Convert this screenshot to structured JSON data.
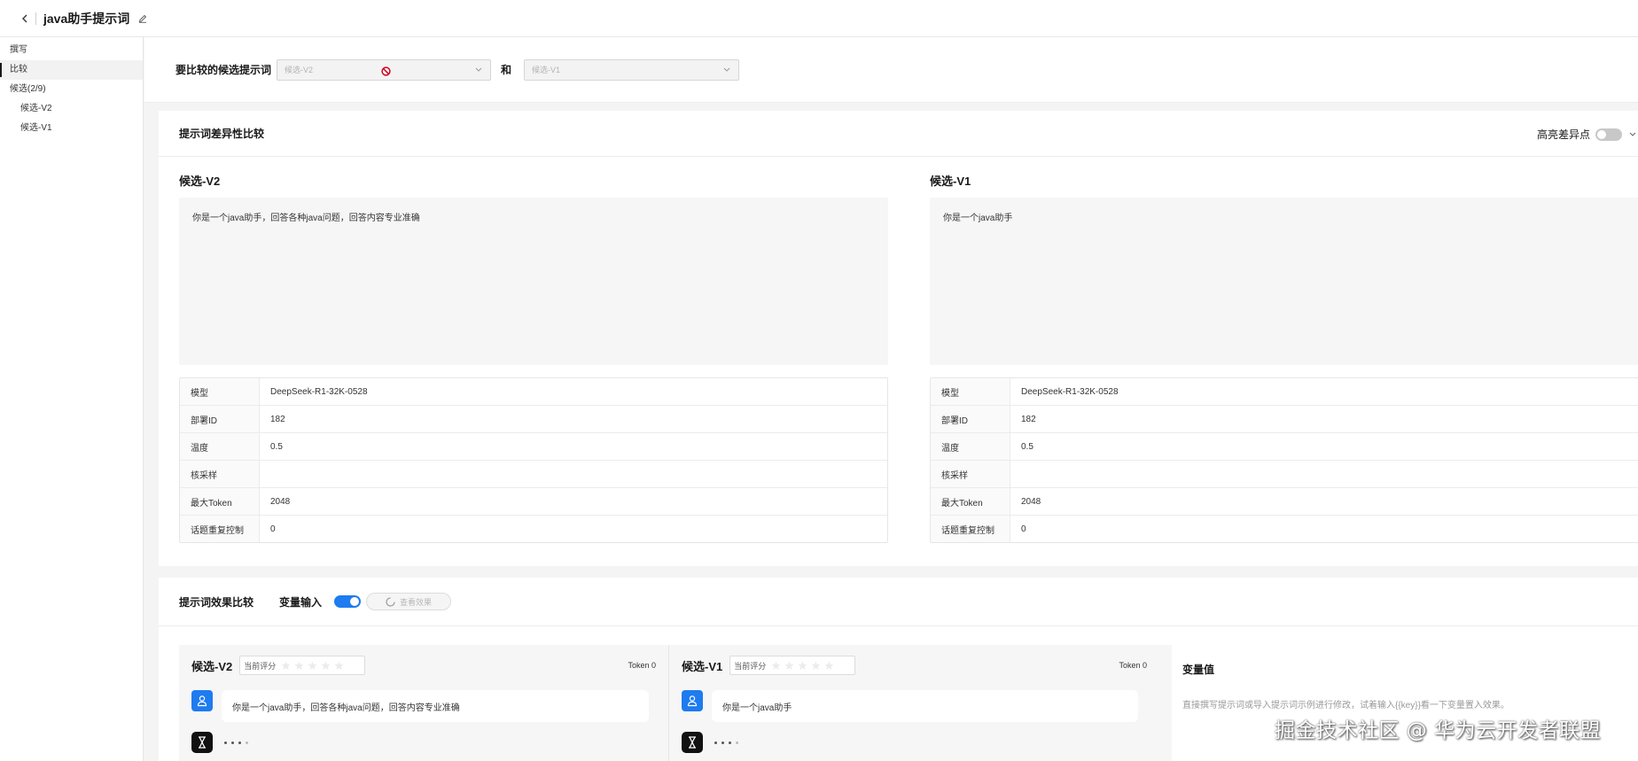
{
  "header": {
    "title": "java助手提示词"
  },
  "sidebar": {
    "items": [
      {
        "label": "撰写"
      },
      {
        "label": "比较"
      },
      {
        "label": "候选(2/9)"
      },
      {
        "label": "候选-V2"
      },
      {
        "label": "候选-V1"
      }
    ]
  },
  "compare_bar": {
    "label": "要比较的候选提示词",
    "select_left": "候选-V2",
    "and": "和",
    "select_right": "候选-V1"
  },
  "diff": {
    "title": "提示词差异性比较",
    "highlight_label": "高亮差异点",
    "highlight_on": false,
    "left": {
      "name": "候选-V2",
      "prompt": "你是一个java助手，回答各种java问题，回答内容专业准确",
      "params": [
        {
          "key": "模型",
          "value": "DeepSeek-R1-32K-0528"
        },
        {
          "key": "部署ID",
          "value": "182"
        },
        {
          "key": "温度",
          "value": "0.5"
        },
        {
          "key": "核采样",
          "value": ""
        },
        {
          "key": "最大Token",
          "value": "2048"
        },
        {
          "key": "话题重复控制",
          "value": "0"
        }
      ]
    },
    "right": {
      "name": "候选-V1",
      "prompt": "你是一个java助手",
      "params": [
        {
          "key": "模型",
          "value": "DeepSeek-R1-32K-0528"
        },
        {
          "key": "部署ID",
          "value": "182"
        },
        {
          "key": "温度",
          "value": "0.5"
        },
        {
          "key": "核采样",
          "value": ""
        },
        {
          "key": "最大Token",
          "value": "2048"
        },
        {
          "key": "话题重复控制",
          "value": "0"
        }
      ]
    }
  },
  "effect": {
    "title": "提示词效果比较",
    "var_input_label": "变量输入",
    "var_input_on": true,
    "view_button": "查看效果",
    "results": [
      {
        "name": "候选-V2",
        "score_label": "当前评分",
        "token": "Token 0",
        "message": "你是一个java助手，回答各种java问题，回答内容专业准确"
      },
      {
        "name": "候选-V1",
        "score_label": "当前评分",
        "token": "Token 0",
        "message": "你是一个java助手"
      }
    ],
    "variables": {
      "title": "变量值",
      "hint": "直接撰写提示词或导入提示词示例进行修改，试着输入{{key}}看一下变量置入效果。"
    }
  },
  "watermark": "掘金技术社区 @ 华为云开发者联盟",
  "colors": {
    "accent": "#1e7bf0",
    "forbid": "#d0021b",
    "bot_avatar": "#111111"
  }
}
